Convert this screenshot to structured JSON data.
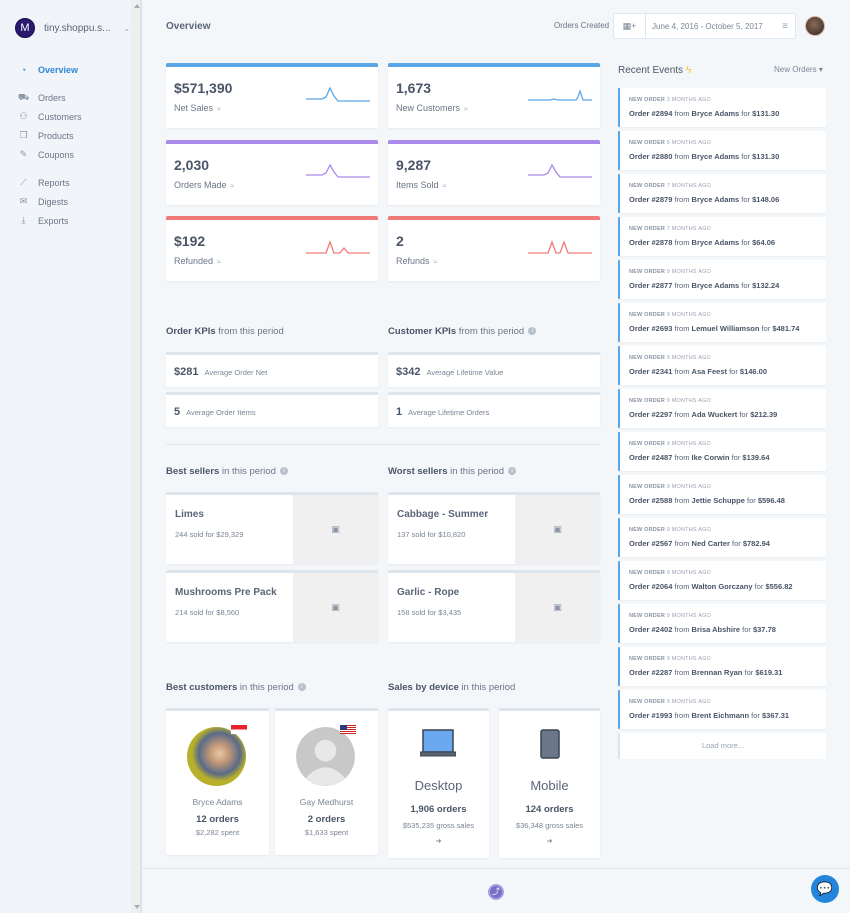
{
  "sidebar": {
    "store_initial": "M",
    "store_name": "tiny.shoppu.s...",
    "items": [
      {
        "label": "Overview",
        "icon": "dashboard-icon",
        "glyph": "◔",
        "active": true
      },
      {
        "label": "Orders",
        "icon": "cart-icon",
        "glyph": "⛟"
      },
      {
        "label": "Customers",
        "icon": "users-icon",
        "glyph": "⚇"
      },
      {
        "label": "Products",
        "icon": "box-icon",
        "glyph": "❒"
      },
      {
        "label": "Coupons",
        "icon": "tag-icon",
        "glyph": "✎"
      },
      {
        "label": "Reports",
        "icon": "chart-icon",
        "glyph": "⟋"
      },
      {
        "label": "Digests",
        "icon": "envelope-icon",
        "glyph": "✉"
      },
      {
        "label": "Exports",
        "icon": "download-icon",
        "glyph": "⤓"
      }
    ]
  },
  "header": {
    "title": "Overview",
    "date_label": "Orders Created",
    "date_range": "June 4, 2016 - October 5, 2017"
  },
  "stats": [
    {
      "value": "$571,390",
      "label": "Net Sales",
      "color": "#5aa7e8"
    },
    {
      "value": "1,673",
      "label": "New Customers",
      "color": "#5aa7e8"
    },
    {
      "value": "2,030",
      "label": "Orders Made",
      "color": "#a98ae8"
    },
    {
      "value": "9,287",
      "label": "Items Sold",
      "color": "#a98ae8"
    },
    {
      "value": "$192",
      "label": "Refunded",
      "color": "#f07a78"
    },
    {
      "value": "2",
      "label": "Refunds",
      "color": "#f07a78"
    }
  ],
  "order_kpis": {
    "title_bold": "Order KPIs",
    "title_rest": " from this period",
    "items": [
      {
        "value": "$281",
        "label": "Average Order Net"
      },
      {
        "value": "5",
        "label": "Average Order Items"
      }
    ]
  },
  "customer_kpis": {
    "title_bold": "Customer KPIs",
    "title_rest": " from this period",
    "items": [
      {
        "value": "$342",
        "label": "Average Lifetime Value"
      },
      {
        "value": "1",
        "label": "Average Lifetime Orders"
      }
    ]
  },
  "best_sellers": {
    "title_bold": "Best sellers",
    "title_rest": " in this period",
    "items": [
      {
        "name": "Limes",
        "detail": "244 sold for $29,329"
      },
      {
        "name": "Mushrooms Pre Pack",
        "detail": "214 sold for $8,560"
      }
    ]
  },
  "worst_sellers": {
    "title_bold": "Worst sellers",
    "title_rest": " in this period",
    "items": [
      {
        "name": "Cabbage - Summer",
        "detail": "137 sold for $10,820"
      },
      {
        "name": "Garlic - Rope",
        "detail": "158 sold for $3,435"
      }
    ]
  },
  "best_customers": {
    "title_bold": "Best customers",
    "title_rest": " in this period",
    "items": [
      {
        "name": "Bryce Adams",
        "orders": "12 orders",
        "spent": "$2,282 spent"
      },
      {
        "name": "Gay Medhurst",
        "orders": "2 orders",
        "spent": "$1,633 spent"
      }
    ]
  },
  "devices": {
    "title_bold": "Sales by device",
    "title_rest": " in this period",
    "items": [
      {
        "name": "Desktop",
        "orders": "1,906 orders",
        "sales": "$535,235 gross sales"
      },
      {
        "name": "Mobile",
        "orders": "124 orders",
        "sales": "$36,348 gross sales"
      }
    ]
  },
  "recent_events": {
    "title": "Recent Events",
    "filter": "New Orders",
    "load_more": "Load more...",
    "items": [
      {
        "type": "NEW ORDER",
        "ago": "3 MONTHS AGO",
        "order": "Order #2894",
        "customer": "Bryce Adams",
        "amount": "$131.30"
      },
      {
        "type": "NEW ORDER",
        "ago": "5 MONTHS AGO",
        "order": "Order #2880",
        "customer": "Bryce Adams",
        "amount": "$131.30"
      },
      {
        "type": "NEW ORDER",
        "ago": "7 MONTHS AGO",
        "order": "Order #2879",
        "customer": "Bryce Adams",
        "amount": "$148.06"
      },
      {
        "type": "NEW ORDER",
        "ago": "7 MONTHS AGO",
        "order": "Order #2878",
        "customer": "Bryce Adams",
        "amount": "$64.06"
      },
      {
        "type": "NEW ORDER",
        "ago": "9 MONTHS AGO",
        "order": "Order #2877",
        "customer": "Bryce Adams",
        "amount": "$132.24"
      },
      {
        "type": "NEW ORDER",
        "ago": "9 MONTHS AGO",
        "order": "Order #2693",
        "customer": "Lemuel Williamson",
        "amount": "$481.74"
      },
      {
        "type": "NEW ORDER",
        "ago": "9 MONTHS AGO",
        "order": "Order #2341",
        "customer": "Asa Feest",
        "amount": "$146.00"
      },
      {
        "type": "NEW ORDER",
        "ago": "9 MONTHS AGO",
        "order": "Order #2297",
        "customer": "Ada Wuckert",
        "amount": "$212.39"
      },
      {
        "type": "NEW ORDER",
        "ago": "9 MONTHS AGO",
        "order": "Order #2487",
        "customer": "Ike Corwin",
        "amount": "$139.64"
      },
      {
        "type": "NEW ORDER",
        "ago": "9 MONTHS AGO",
        "order": "Order #2588",
        "customer": "Jettie Schuppe",
        "amount": "$596.48"
      },
      {
        "type": "NEW ORDER",
        "ago": "9 MONTHS AGO",
        "order": "Order #2567",
        "customer": "Ned Carter",
        "amount": "$782.94"
      },
      {
        "type": "NEW ORDER",
        "ago": "9 MONTHS AGO",
        "order": "Order #2064",
        "customer": "Walton Gorczany",
        "amount": "$556.82"
      },
      {
        "type": "NEW ORDER",
        "ago": "9 MONTHS AGO",
        "order": "Order #2402",
        "customer": "Brisa Abshire",
        "amount": "$37.78"
      },
      {
        "type": "NEW ORDER",
        "ago": "9 MONTHS AGO",
        "order": "Order #2287",
        "customer": "Brennan Ryan",
        "amount": "$619.31"
      },
      {
        "type": "NEW ORDER",
        "ago": "9 MONTHS AGO",
        "order": "Order #1993",
        "customer": "Brent Eichmann",
        "amount": "$367.31"
      }
    ],
    "connectors": {
      "from": " from ",
      "for": " for "
    }
  }
}
